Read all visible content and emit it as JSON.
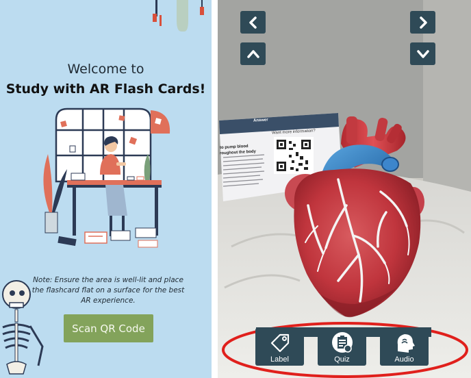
{
  "left_screen": {
    "welcome_text": "Welcome to",
    "title_text": "Study with AR Flash Cards!",
    "note_text": "Note: Ensure the area is well-lit and place the flashcard flat on a surface for the best AR experience.",
    "scan_button_label": "Scan QR Code",
    "colors": {
      "background": "#bcdcf0",
      "scan_button": "#83a35b",
      "accent_red": "#e0705a",
      "navy": "#2c3a55"
    }
  },
  "ar_view": {
    "nav_buttons": [
      {
        "name": "previous-button",
        "icon": "chevron-left-icon"
      },
      {
        "name": "next-button",
        "icon": "chevron-right-icon"
      },
      {
        "name": "expand-up-button",
        "icon": "chevron-up-icon"
      },
      {
        "name": "collapse-down-button",
        "icon": "chevron-down-icon"
      }
    ],
    "card": {
      "header": "Answer",
      "more_info": "Want more information?",
      "snippet_line1": "to pump blood",
      "snippet_line2": "roughout the body"
    },
    "toolbar": {
      "label_button": "Label",
      "quiz_button": "Quiz",
      "audio_button": "Audio"
    },
    "colors": {
      "button_bg": "#2f4a57",
      "highlight_ellipse": "#e0201c",
      "heart_red": "#c4343b",
      "artery_blue": "#2f7fc4"
    }
  }
}
